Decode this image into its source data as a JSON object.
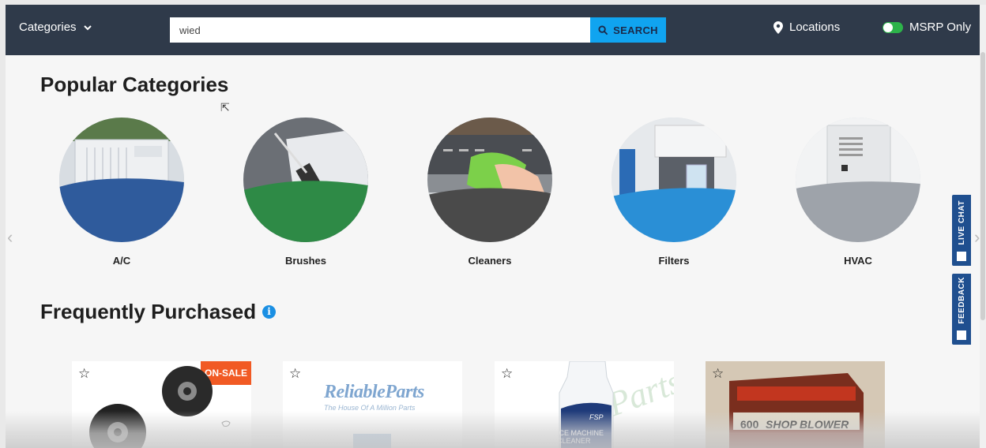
{
  "header": {
    "categories_label": "Categories",
    "search_value": "wied",
    "search_button": "SEARCH",
    "locations_label": "Locations",
    "msrp_label": "MSRP Only",
    "msrp_on": true
  },
  "popular": {
    "title": "Popular Categories",
    "items": [
      {
        "label": "A/C"
      },
      {
        "label": "Brushes"
      },
      {
        "label": "Cleaners"
      },
      {
        "label": "Filters"
      },
      {
        "label": "HVAC"
      }
    ]
  },
  "frequent": {
    "title": "Frequently Purchased",
    "info_icon": "i",
    "cards": [
      {
        "badge": "ON-SALE"
      },
      {
        "brand": "ReliableParts",
        "tagline": "The House Of A Million Parts"
      },
      {
        "product_text_1": "ICE MACHINE",
        "product_text_2": "CLEANER",
        "logo": "FSP"
      },
      {
        "product_text": "SHOP BLOWER",
        "box_text": "600"
      }
    ]
  },
  "side_tabs": {
    "live_chat": "LIVE CHAT",
    "feedback": "FEEDBACK"
  },
  "colors": {
    "header_bg": "#2f3a4a",
    "search_button": "#10a4f0",
    "sale_badge": "#f15a24",
    "side_tab": "#1f4f8f",
    "toggle_on": "#2db34a"
  }
}
